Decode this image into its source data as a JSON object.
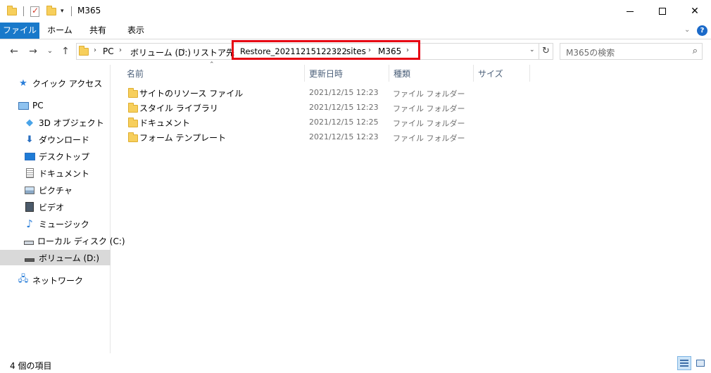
{
  "window": {
    "title": "M365",
    "quick_access_dropdown": "▾",
    "minimize": "—",
    "maximize": "☐",
    "close": "✕"
  },
  "ribbon": {
    "tabs": [
      "ファイル",
      "ホーム",
      "共有",
      "表示"
    ],
    "collapse_icon": "⌄",
    "help_icon": "?"
  },
  "nav": {
    "back": "←",
    "forward": "→",
    "recent": "⌄",
    "up": "↑"
  },
  "address": {
    "breadcrumbs": [
      "PC",
      "ボリューム (D:)",
      "リストア先",
      "Restore_20211215122322",
      "sites",
      "M365"
    ],
    "separator": "›",
    "dropdown": "⌄",
    "refresh": "↻",
    "highlight_color": "#e60012"
  },
  "search": {
    "placeholder": "M365の検索",
    "icon": "⌕"
  },
  "sidebar": {
    "items": [
      {
        "label": "クイック アクセス",
        "icon": "star-icon"
      },
      {
        "label": "PC",
        "icon": "pc-icon"
      },
      {
        "label": "3D オブジェクト",
        "icon": "cube-icon"
      },
      {
        "label": "ダウンロード",
        "icon": "download-icon"
      },
      {
        "label": "デスクトップ",
        "icon": "desktop-icon"
      },
      {
        "label": "ドキュメント",
        "icon": "document-icon"
      },
      {
        "label": "ピクチャ",
        "icon": "picture-icon"
      },
      {
        "label": "ビデオ",
        "icon": "video-icon"
      },
      {
        "label": "ミュージック",
        "icon": "music-icon"
      },
      {
        "label": "ローカル ディスク (C:)",
        "icon": "disk-icon"
      },
      {
        "label": "ボリューム (D:)",
        "icon": "drive-icon",
        "selected": true
      },
      {
        "label": "ネットワーク",
        "icon": "network-icon"
      }
    ]
  },
  "columns": {
    "name": "名前",
    "modified": "更新日時",
    "type": "種類",
    "size": "サイズ",
    "sort_indicator": "⌃"
  },
  "files": [
    {
      "name": "サイトのリソース ファイル",
      "modified": "2021/12/15 12:23",
      "type": "ファイル フォルダー"
    },
    {
      "name": "スタイル ライブラリ",
      "modified": "2021/12/15 12:23",
      "type": "ファイル フォルダー"
    },
    {
      "name": "ドキュメント",
      "modified": "2021/12/15 12:25",
      "type": "ファイル フォルダー"
    },
    {
      "name": "フォーム テンプレート",
      "modified": "2021/12/15 12:23",
      "type": "ファイル フォルダー"
    }
  ],
  "status": {
    "item_count": "4 個の項目"
  },
  "colors": {
    "file_tab": "#1979ca",
    "folder": "#f7cf5c",
    "selection": "#d9d9d9"
  }
}
